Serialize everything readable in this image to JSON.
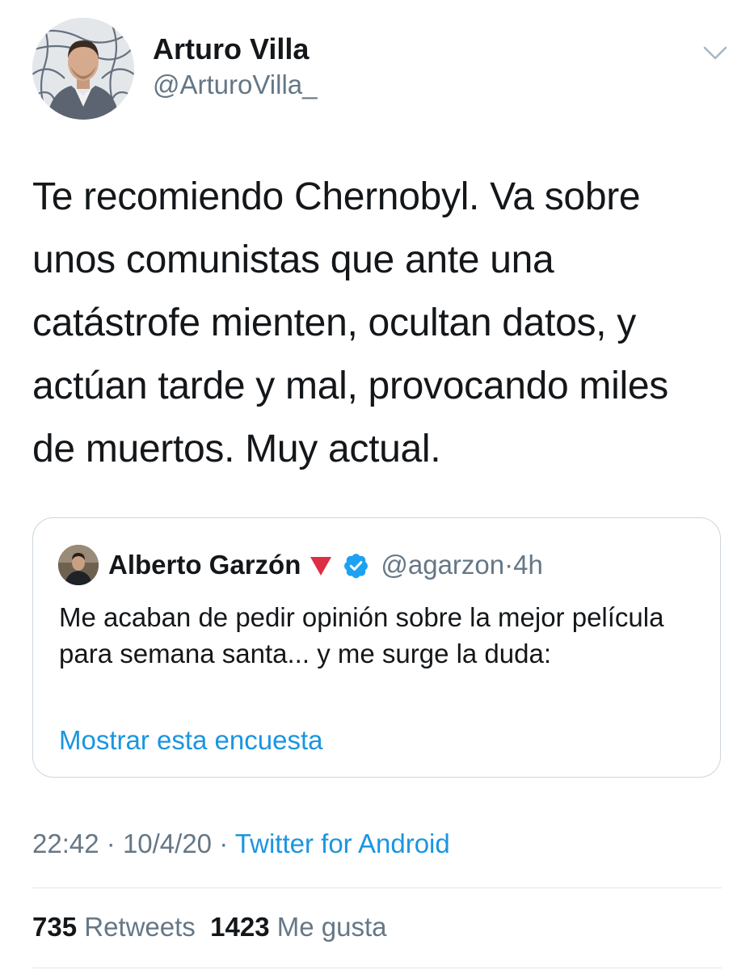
{
  "author": {
    "name": "Arturo Villa",
    "handle": "@ArturoVilla_"
  },
  "tweet": {
    "text": "Te recomiendo Chernobyl. Va sobre\nunos comunistas que ante una\ncatástrofe mienten, ocultan datos, y\nactúan tarde y mal, provocando miles\nde muertos. Muy actual."
  },
  "quoted": {
    "name": "Alberto Garzón",
    "handle": "@agarzon",
    "separator": "·",
    "time": "4h",
    "text": "Me acaban de pedir opinión sobre la mejor película para semana santa... y me surge la duda:",
    "poll_link": "Mostrar esta encuesta",
    "badges": [
      "red-triangle-emoji",
      "verified-badge-icon"
    ]
  },
  "meta": {
    "time": "22:42",
    "separator": "·",
    "date": "10/4/20",
    "source": "Twitter for Android"
  },
  "stats": {
    "retweets_count": "735",
    "retweets_label": "Retweets",
    "likes_count": "1423",
    "likes_label": "Me gusta"
  },
  "colors": {
    "text": "#14171a",
    "secondary": "#657786",
    "link": "#1b95e0",
    "border": "#ccd6dd",
    "verified": "#1da1f2",
    "triangle": "#dd2e44"
  },
  "icons": {
    "menu": "chevron-down-icon"
  }
}
